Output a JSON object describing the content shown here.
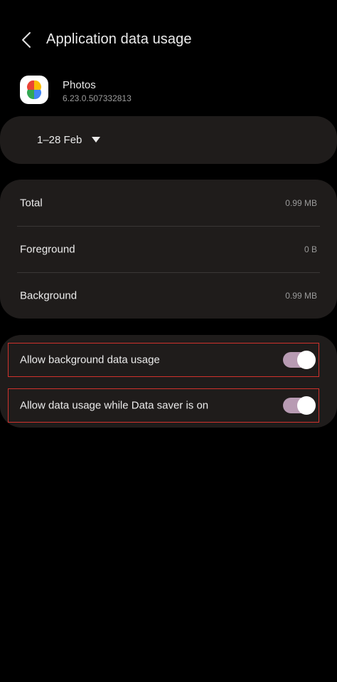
{
  "header": {
    "title": "Application data usage",
    "back_icon": "chevron-left-icon"
  },
  "app": {
    "name": "Photos",
    "version": "6.23.0.507332813",
    "icon": "google-photos-pinwheel-icon"
  },
  "period": {
    "label": "1–28 Feb",
    "icon": "caret-down-icon"
  },
  "usage": {
    "rows": [
      {
        "label": "Total",
        "value": "0.99 MB"
      },
      {
        "label": "Foreground",
        "value": "0 B"
      },
      {
        "label": "Background",
        "value": "0.99 MB"
      }
    ]
  },
  "toggles": {
    "items": [
      {
        "label": "Allow background data usage",
        "enabled": true
      },
      {
        "label": "Allow data usage while Data saver is on",
        "enabled": true
      }
    ]
  },
  "colors": {
    "background": "#000000",
    "card": "#1f1c1b",
    "switch_track_on": "#b89bb3",
    "highlight_border": "#d0322d"
  }
}
